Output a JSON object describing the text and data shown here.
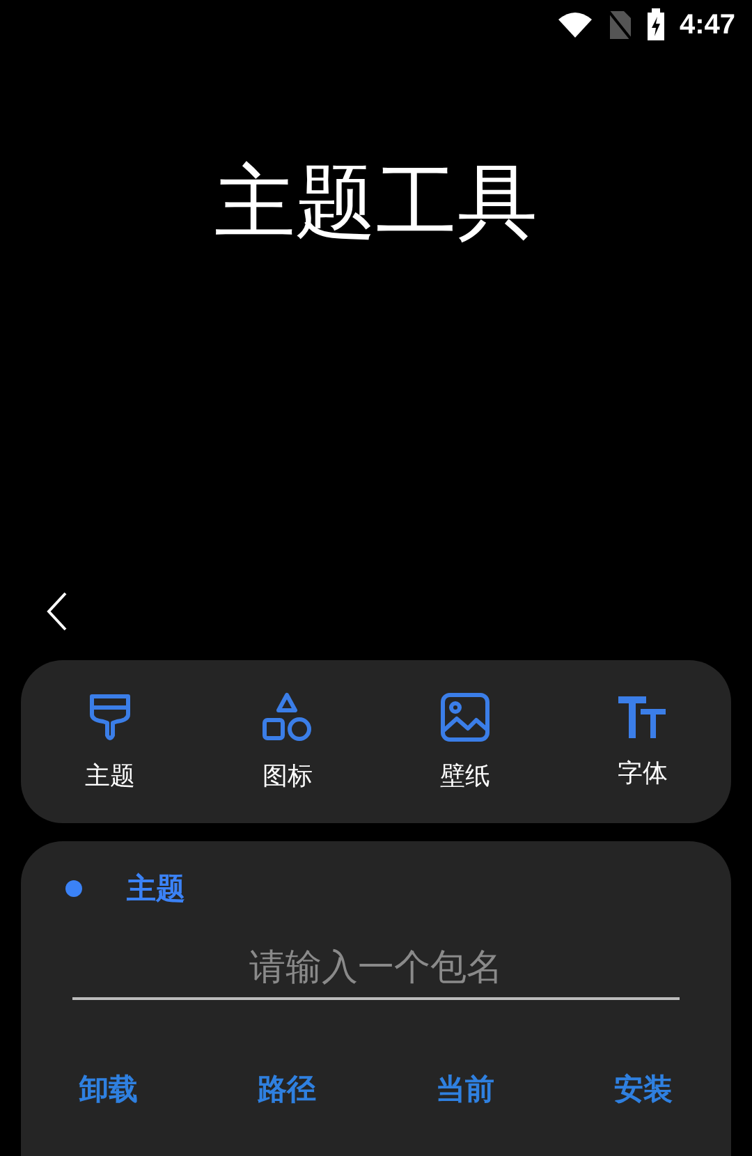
{
  "status_bar": {
    "time": "4:47"
  },
  "title": "主题工具",
  "categories": [
    {
      "label": "主题",
      "kind": "brush"
    },
    {
      "label": "图标",
      "kind": "shapes"
    },
    {
      "label": "壁纸",
      "kind": "image"
    },
    {
      "label": "字体",
      "kind": "font"
    }
  ],
  "section": {
    "label": "主题",
    "color": "#3b82f6"
  },
  "package_field": {
    "placeholder": "请输入一个包名"
  },
  "actions": [
    "卸载",
    "路径",
    "当前",
    "安装"
  ]
}
